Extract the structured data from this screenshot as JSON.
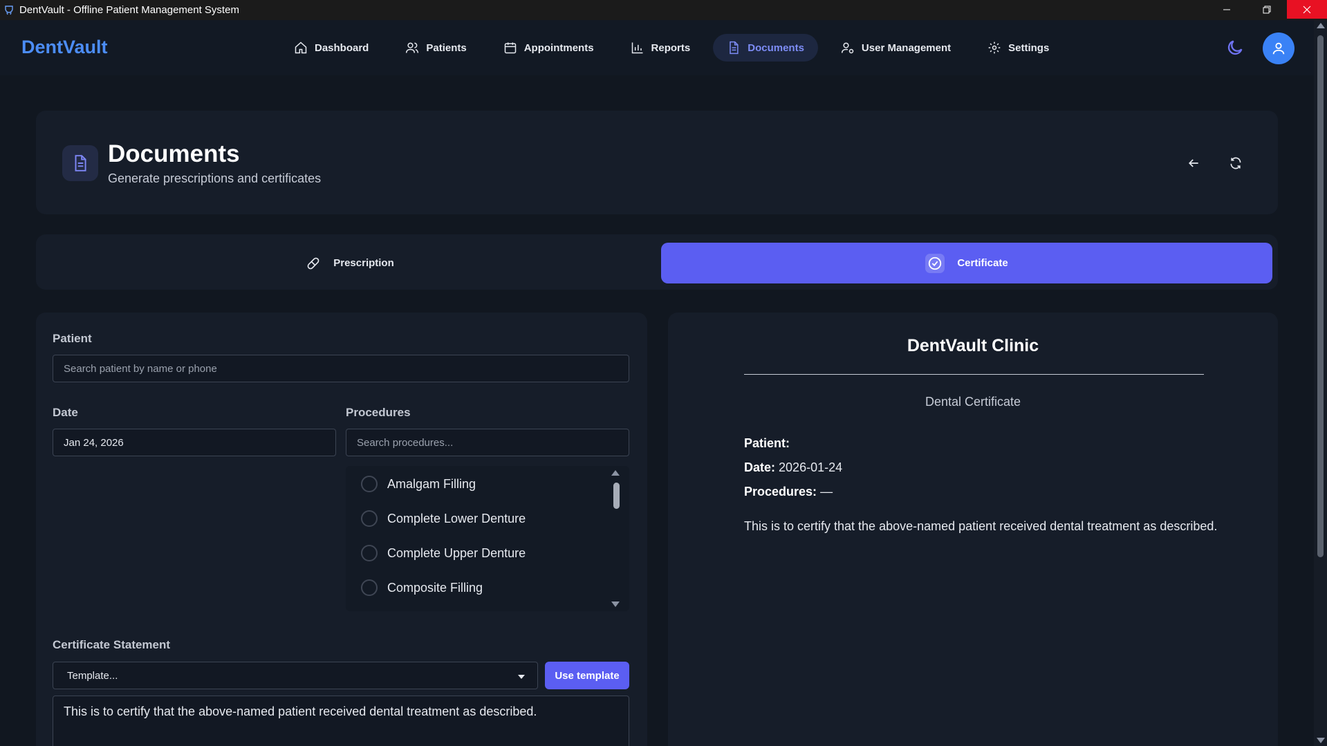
{
  "window": {
    "title": "DentVault - Offline Patient Management System"
  },
  "nav": {
    "brand": "DentVault",
    "items": [
      {
        "label": "Dashboard",
        "icon": "home-icon"
      },
      {
        "label": "Patients",
        "icon": "users-icon"
      },
      {
        "label": "Appointments",
        "icon": "calendar-icon"
      },
      {
        "label": "Reports",
        "icon": "bar-chart-icon"
      },
      {
        "label": "Documents",
        "icon": "document-icon",
        "active": true
      },
      {
        "label": "User Management",
        "icon": "user-gear-icon"
      },
      {
        "label": "Settings",
        "icon": "gear-icon"
      }
    ],
    "accent_color": "#7d8cf5"
  },
  "header": {
    "title": "Documents",
    "subtitle": "Generate prescriptions and certificates"
  },
  "tabs": [
    {
      "label": "Prescription",
      "icon": "pill-icon",
      "active": false
    },
    {
      "label": "Certificate",
      "icon": "check-circle-icon",
      "active": true
    }
  ],
  "form": {
    "patient_label": "Patient",
    "patient_placeholder": "Search patient by name or phone",
    "date_label": "Date",
    "date_value": "Jan 24, 2026",
    "procedures_label": "Procedures",
    "procedures_placeholder": "Search procedures...",
    "procedures": [
      "Amalgam Filling",
      "Complete Lower Denture",
      "Complete Upper Denture",
      "Composite Filling"
    ],
    "statement_label": "Certificate Statement",
    "template_select": "Template...",
    "use_template_label": "Use template",
    "statement_text": "This is to certify that the above-named patient received dental treatment as described."
  },
  "preview": {
    "clinic_name": "DentVault Clinic",
    "doc_type": "Dental Certificate",
    "patient_label": "Patient:",
    "patient_value": "",
    "date_label": "Date:",
    "date_value": "2026-01-24",
    "procedures_label": "Procedures:",
    "procedures_value": "—",
    "body": "This is to certify that the above-named patient received dental treatment as described."
  },
  "colors": {
    "primary": "#5b5ef2",
    "brand": "#4c8df7",
    "background": "#111720",
    "card": "#161d29"
  }
}
